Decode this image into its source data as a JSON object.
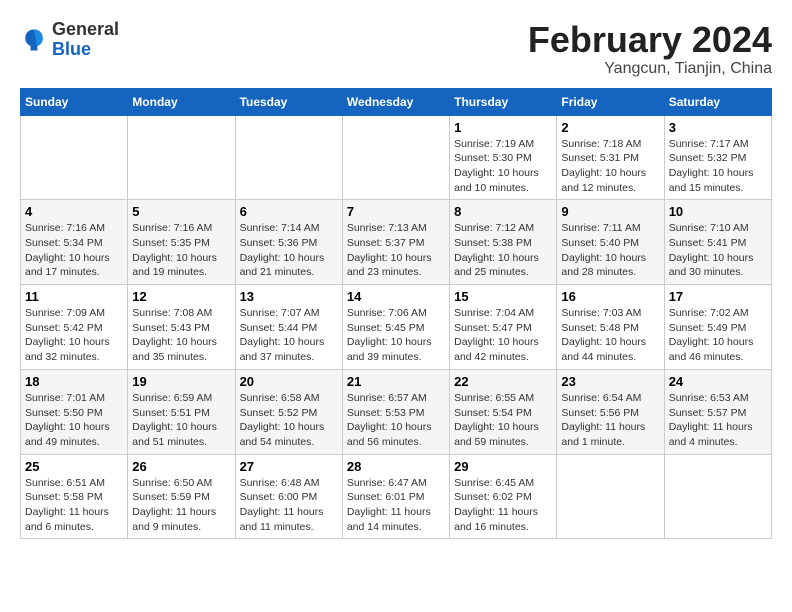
{
  "header": {
    "logo_general": "General",
    "logo_blue": "Blue",
    "month_title": "February 2024",
    "location": "Yangcun, Tianjin, China"
  },
  "days_of_week": [
    "Sunday",
    "Monday",
    "Tuesday",
    "Wednesday",
    "Thursday",
    "Friday",
    "Saturday"
  ],
  "weeks": [
    [
      null,
      null,
      null,
      null,
      {
        "day": 1,
        "sunrise": "7:19 AM",
        "sunset": "5:30 PM",
        "daylight": "10 hours and 10 minutes."
      },
      {
        "day": 2,
        "sunrise": "7:18 AM",
        "sunset": "5:31 PM",
        "daylight": "10 hours and 12 minutes."
      },
      {
        "day": 3,
        "sunrise": "7:17 AM",
        "sunset": "5:32 PM",
        "daylight": "10 hours and 15 minutes."
      }
    ],
    [
      {
        "day": 4,
        "sunrise": "7:16 AM",
        "sunset": "5:34 PM",
        "daylight": "10 hours and 17 minutes."
      },
      {
        "day": 5,
        "sunrise": "7:16 AM",
        "sunset": "5:35 PM",
        "daylight": "10 hours and 19 minutes."
      },
      {
        "day": 6,
        "sunrise": "7:14 AM",
        "sunset": "5:36 PM",
        "daylight": "10 hours and 21 minutes."
      },
      {
        "day": 7,
        "sunrise": "7:13 AM",
        "sunset": "5:37 PM",
        "daylight": "10 hours and 23 minutes."
      },
      {
        "day": 8,
        "sunrise": "7:12 AM",
        "sunset": "5:38 PM",
        "daylight": "10 hours and 25 minutes."
      },
      {
        "day": 9,
        "sunrise": "7:11 AM",
        "sunset": "5:40 PM",
        "daylight": "10 hours and 28 minutes."
      },
      {
        "day": 10,
        "sunrise": "7:10 AM",
        "sunset": "5:41 PM",
        "daylight": "10 hours and 30 minutes."
      }
    ],
    [
      {
        "day": 11,
        "sunrise": "7:09 AM",
        "sunset": "5:42 PM",
        "daylight": "10 hours and 32 minutes."
      },
      {
        "day": 12,
        "sunrise": "7:08 AM",
        "sunset": "5:43 PM",
        "daylight": "10 hours and 35 minutes."
      },
      {
        "day": 13,
        "sunrise": "7:07 AM",
        "sunset": "5:44 PM",
        "daylight": "10 hours and 37 minutes."
      },
      {
        "day": 14,
        "sunrise": "7:06 AM",
        "sunset": "5:45 PM",
        "daylight": "10 hours and 39 minutes."
      },
      {
        "day": 15,
        "sunrise": "7:04 AM",
        "sunset": "5:47 PM",
        "daylight": "10 hours and 42 minutes."
      },
      {
        "day": 16,
        "sunrise": "7:03 AM",
        "sunset": "5:48 PM",
        "daylight": "10 hours and 44 minutes."
      },
      {
        "day": 17,
        "sunrise": "7:02 AM",
        "sunset": "5:49 PM",
        "daylight": "10 hours and 46 minutes."
      }
    ],
    [
      {
        "day": 18,
        "sunrise": "7:01 AM",
        "sunset": "5:50 PM",
        "daylight": "10 hours and 49 minutes."
      },
      {
        "day": 19,
        "sunrise": "6:59 AM",
        "sunset": "5:51 PM",
        "daylight": "10 hours and 51 minutes."
      },
      {
        "day": 20,
        "sunrise": "6:58 AM",
        "sunset": "5:52 PM",
        "daylight": "10 hours and 54 minutes."
      },
      {
        "day": 21,
        "sunrise": "6:57 AM",
        "sunset": "5:53 PM",
        "daylight": "10 hours and 56 minutes."
      },
      {
        "day": 22,
        "sunrise": "6:55 AM",
        "sunset": "5:54 PM",
        "daylight": "10 hours and 59 minutes."
      },
      {
        "day": 23,
        "sunrise": "6:54 AM",
        "sunset": "5:56 PM",
        "daylight": "11 hours and 1 minute."
      },
      {
        "day": 24,
        "sunrise": "6:53 AM",
        "sunset": "5:57 PM",
        "daylight": "11 hours and 4 minutes."
      }
    ],
    [
      {
        "day": 25,
        "sunrise": "6:51 AM",
        "sunset": "5:58 PM",
        "daylight": "11 hours and 6 minutes."
      },
      {
        "day": 26,
        "sunrise": "6:50 AM",
        "sunset": "5:59 PM",
        "daylight": "11 hours and 9 minutes."
      },
      {
        "day": 27,
        "sunrise": "6:48 AM",
        "sunset": "6:00 PM",
        "daylight": "11 hours and 11 minutes."
      },
      {
        "day": 28,
        "sunrise": "6:47 AM",
        "sunset": "6:01 PM",
        "daylight": "11 hours and 14 minutes."
      },
      {
        "day": 29,
        "sunrise": "6:45 AM",
        "sunset": "6:02 PM",
        "daylight": "11 hours and 16 minutes."
      },
      null,
      null
    ]
  ]
}
